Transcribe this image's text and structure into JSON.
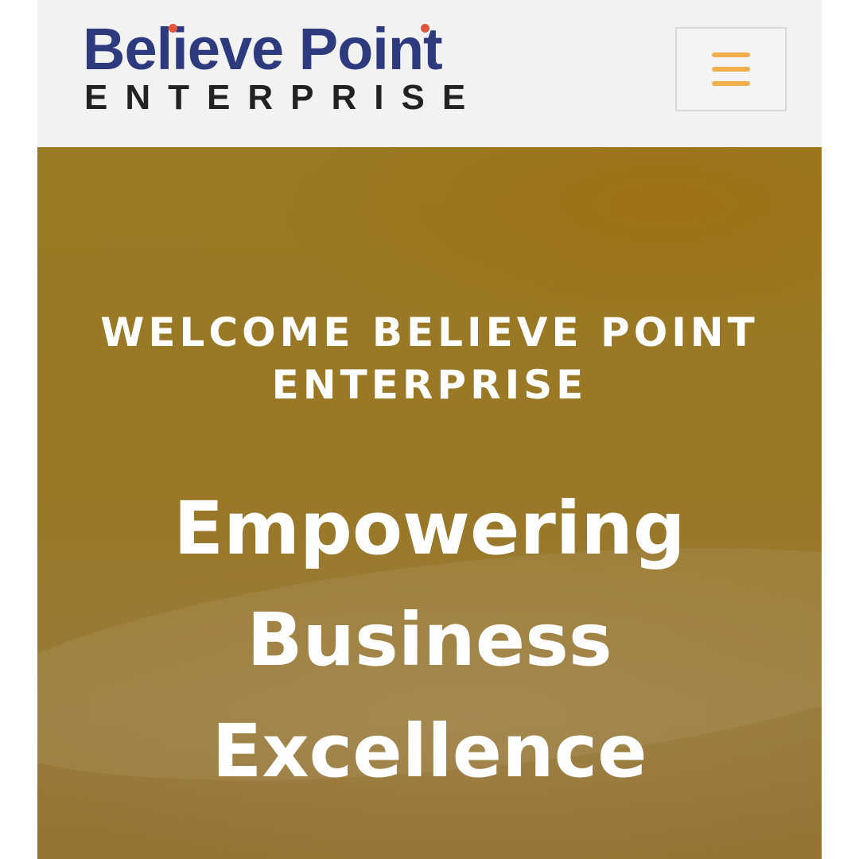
{
  "header": {
    "logo": {
      "main": "Believe Point",
      "sub": "ENTERPRISE"
    },
    "menu_icon": "hamburger-menu-icon"
  },
  "hero": {
    "kicker": "WELCOME BELIEVE POINT ENTERPRISE",
    "title_lines": [
      "Empowering",
      "Business",
      "Excellence"
    ]
  },
  "colors": {
    "logo_blue": "#2e3a7e",
    "logo_dot": "#e0563c",
    "menu_accent": "#f2ae4a",
    "hero_gold": "#9a7a25",
    "header_bg": "#f2f2f2"
  }
}
